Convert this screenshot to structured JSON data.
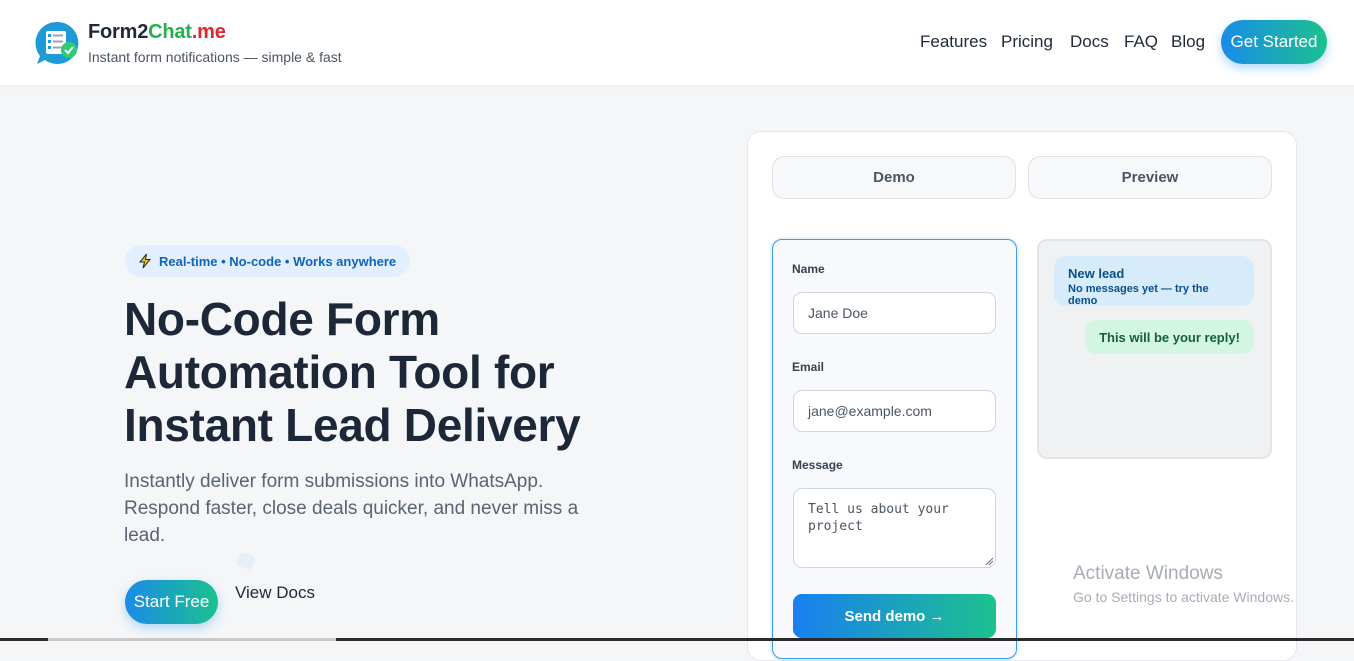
{
  "header": {
    "brand": {
      "part1": "Form2",
      "part2": "Chat",
      "part3": ".me"
    },
    "tagline": "Instant form notifications — simple & fast",
    "nav": [
      "Features",
      "Pricing",
      "Docs",
      "FAQ",
      "Blog"
    ],
    "cta_label": "Get Started"
  },
  "hero": {
    "badge": "Real-time • No-code • Works anywhere",
    "title_line1": "No-Code Form",
    "title_line2": "Automation Tool for",
    "title_line3": "Instant Lead Delivery",
    "subtitle": "Instantly deliver form submissions into WhatsApp. Respond faster, close deals quicker, and never miss a lead.",
    "start_label": "Start Free",
    "docs_label": "View Docs"
  },
  "demo": {
    "tabs": [
      "Demo",
      "Preview"
    ],
    "form": {
      "name_label": "Name",
      "name_placeholder": "Jane Doe",
      "email_label": "Email",
      "email_placeholder": "jane@example.com",
      "message_label": "Message",
      "message_placeholder": "Tell us about your project",
      "send_label": "Send demo →"
    },
    "preview": {
      "incoming_title": "New lead",
      "incoming_text": "No messages yet — try the demo",
      "outgoing_text": "This will be your reply!"
    }
  },
  "system": {
    "watermark_title": "Activate Windows",
    "watermark_text": "Go to Settings to activate Windows."
  },
  "colors": {
    "accent_blue": "#1a8be9",
    "accent_green": "#1cc18e",
    "brand_green": "#22b14c",
    "brand_red": "#e0262b"
  }
}
